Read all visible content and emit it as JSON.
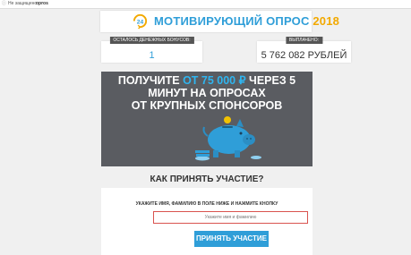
{
  "browser": {
    "site_label": "Не защищено",
    "path_label": "opros"
  },
  "header": {
    "title_main": "МОТИВИРУЮЩИЙ ОПРОС ",
    "title_year": "2018",
    "logo_number": "24"
  },
  "stats": {
    "left": {
      "label": "ОСТАЛОСЬ ДЕНЕЖНЫХ БОНУСОВ:",
      "value": "1"
    },
    "right": {
      "label": "ВЫПЛАЧЕНО:",
      "value": "5 762 082 РУБЛЕЙ"
    }
  },
  "hero": {
    "line1_prefix": "ПОЛУЧИТЕ ",
    "line1_amount": "ОТ 75 000 ₽",
    "line1_suffix": " ЧЕРЕЗ 5 МИНУТ НА ОПРОСАХ",
    "line2": "ОТ КРУПНЫХ СПОНСОРОВ"
  },
  "question": "КАК ПРИНЯТЬ УЧАСТИЕ?",
  "form": {
    "instruction": "УКАЖИТЕ ИМЯ, ФАМИЛИЮ В ПОЛЕ НИЖЕ И НАЖМИТЕ КНОПКУ",
    "name_placeholder": "Укажите имя и фамилию",
    "submit_label": "ПРИНЯТЬ УЧАСТИЕ"
  },
  "colors": {
    "accent": "#2f9ed8",
    "highlight": "#2fb5f0",
    "year": "#f2a900",
    "hero_bg": "#5a5c61",
    "input_border": "#d9534f"
  },
  "icons": {
    "lock": "info-icon",
    "logo": "clock-24-icon",
    "hero": "piggy-bank-icon"
  }
}
